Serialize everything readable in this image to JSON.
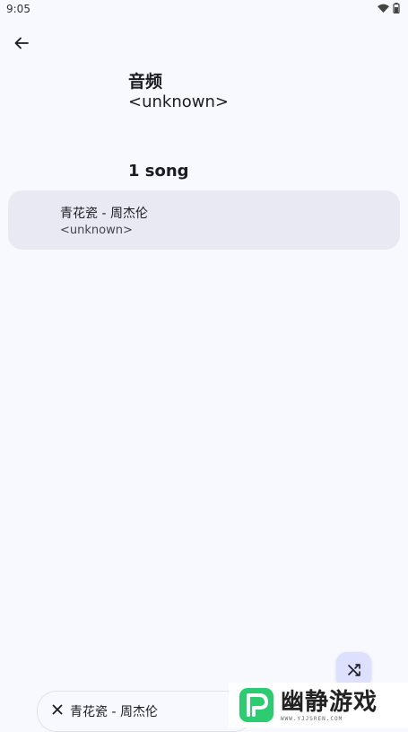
{
  "status_bar": {
    "time": "9:05"
  },
  "header": {
    "album_title": "音频",
    "album_artist": "<unknown>",
    "song_count": "1 song"
  },
  "songs": [
    {
      "title": "青花瓷 - 周杰伦",
      "artist": "<unknown>"
    }
  ],
  "mini_player": {
    "title": "青花瓷 - 周杰伦"
  },
  "watermark": {
    "name": "幽静游戏",
    "url": "WWW.YJJSREN.COM"
  },
  "colors": {
    "background": "#f8f8ff",
    "song_item_bg": "#e9e9f4",
    "fab_bg": "#dde1ff",
    "logo_green": "#2ecc71"
  }
}
